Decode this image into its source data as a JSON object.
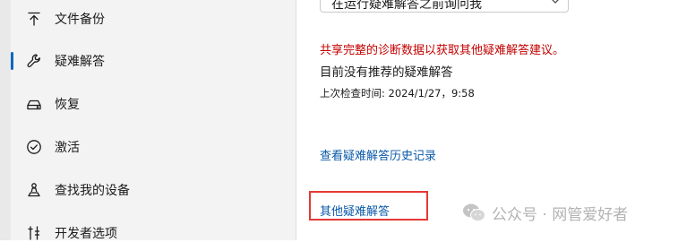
{
  "sidebar": {
    "items": [
      {
        "label": "文件备份",
        "icon": "upload-arrow-icon"
      },
      {
        "label": "疑难解答",
        "icon": "wrench-icon",
        "active": true
      },
      {
        "label": "恢复",
        "icon": "recovery-drive-icon"
      },
      {
        "label": "激活",
        "icon": "check-circle-icon"
      },
      {
        "label": "查找我的设备",
        "icon": "person-location-icon"
      },
      {
        "label": "开发者选项",
        "icon": "developer-tools-icon"
      }
    ]
  },
  "main": {
    "dropdown_value": "在运行疑难解答之前询问我",
    "share_warning": "共享完整的诊断数据以获取其他疑难解答建议。",
    "no_recommendation": "目前没有推荐的疑难解答",
    "last_checked": "上次检查时间: 2024/1/27，9:58",
    "history_link": "查看疑难解答历史记录",
    "other_link": "其他疑难解答"
  },
  "watermark": {
    "text": "公众号 · 网管爱好者",
    "icon": "wechat-logo-icon"
  },
  "colors": {
    "accent": "#0067c0",
    "warning": "#c40000",
    "link": "#0a5aa8",
    "highlight_box": "#e53935"
  }
}
